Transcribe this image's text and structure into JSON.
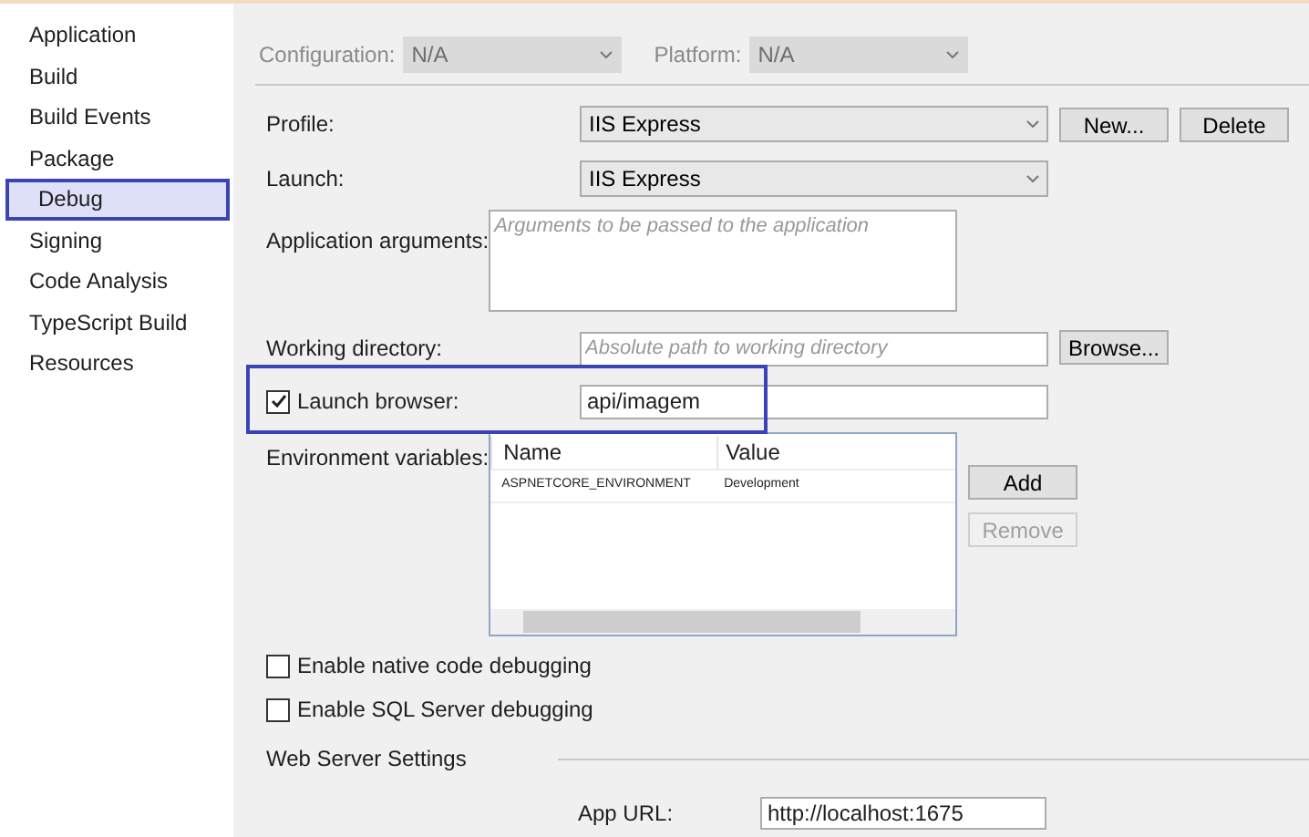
{
  "sidebar": {
    "items": [
      {
        "label": "Application",
        "selected": false
      },
      {
        "label": "Build",
        "selected": false
      },
      {
        "label": "Build Events",
        "selected": false
      },
      {
        "label": "Package",
        "selected": false
      },
      {
        "label": "Debug",
        "selected": true
      },
      {
        "label": "Signing",
        "selected": false
      },
      {
        "label": "Code Analysis",
        "selected": false
      },
      {
        "label": "TypeScript Build",
        "selected": false
      },
      {
        "label": "Resources",
        "selected": false
      }
    ]
  },
  "config_bar": {
    "configuration": {
      "label": "Configuration:",
      "value": "N/A",
      "disabled": true
    },
    "platform": {
      "label": "Platform:",
      "value": "N/A",
      "disabled": true
    }
  },
  "profile": {
    "label": "Profile:",
    "value": "IIS Express",
    "buttons": [
      {
        "label": "New...",
        "disabled": false
      },
      {
        "label": "Delete",
        "disabled": false
      }
    ]
  },
  "launch": {
    "label": "Launch:",
    "value": "IIS Express"
  },
  "app_arguments": {
    "label": "Application arguments:",
    "placeholder": "Arguments to be passed to the application"
  },
  "working_directory": {
    "label": "Working directory:",
    "placeholder": "Absolute path to working directory",
    "button": "Browse..."
  },
  "launch_browser": {
    "label": "Launch browser:",
    "checked": true,
    "value": "api/imagem",
    "highlighted": true
  },
  "environment_variables": {
    "label": "Environment variables:",
    "columns": [
      "Name",
      "Value"
    ],
    "rows": [
      [
        "ASPNETCORE_ENVIRONMENT",
        "Development"
      ]
    ],
    "buttons": [
      {
        "label": "Add",
        "disabled": false
      },
      {
        "label": "Remove",
        "disabled": true
      }
    ]
  },
  "options": [
    {
      "label": "Enable native code debugging",
      "checked": false
    },
    {
      "label": "Enable SQL Server debugging",
      "checked": false
    }
  ],
  "web_server_settings": {
    "title": "Web Server Settings",
    "app_url": {
      "label": "App URL:",
      "value": "http://localhost:1675"
    }
  }
}
